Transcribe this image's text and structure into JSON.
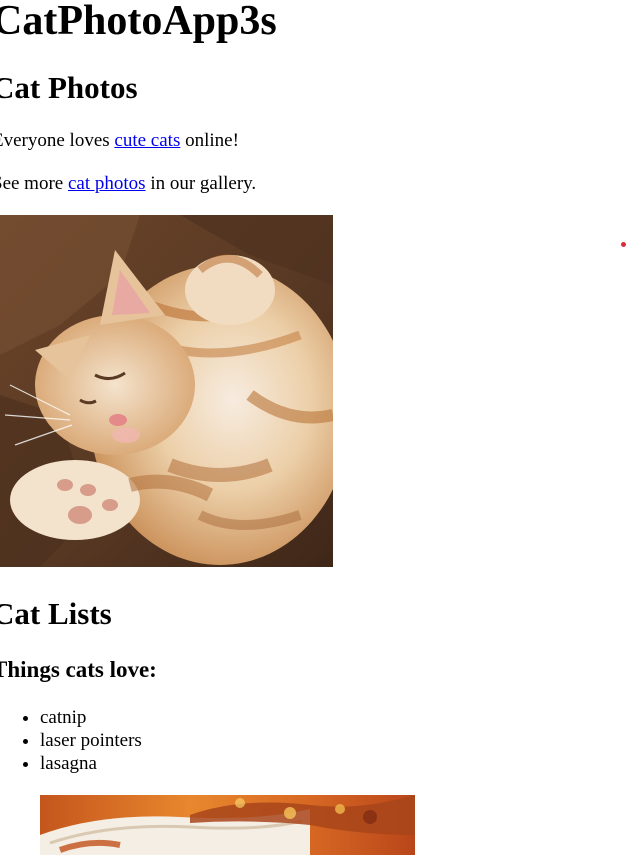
{
  "header": {
    "title": "CatPhotoApp3s"
  },
  "photos_section": {
    "heading": "Cat Photos",
    "line1": {
      "before": "Everyone loves ",
      "link": "cute cats",
      "after": " online!"
    },
    "line2": {
      "before": "See more ",
      "link": "cat photos",
      "after": " in our gallery."
    },
    "image_alt": "A cute orange cat lying on its back."
  },
  "lists_section": {
    "heading": "Cat Lists",
    "subheading": "Things cats love:",
    "items": [
      "catnip",
      "laser pointers",
      "lasagna"
    ],
    "image_alt": "A slice of lasagna on a plate."
  },
  "colors": {
    "link": "#0000ee",
    "marker_dot": "#e0283c"
  }
}
